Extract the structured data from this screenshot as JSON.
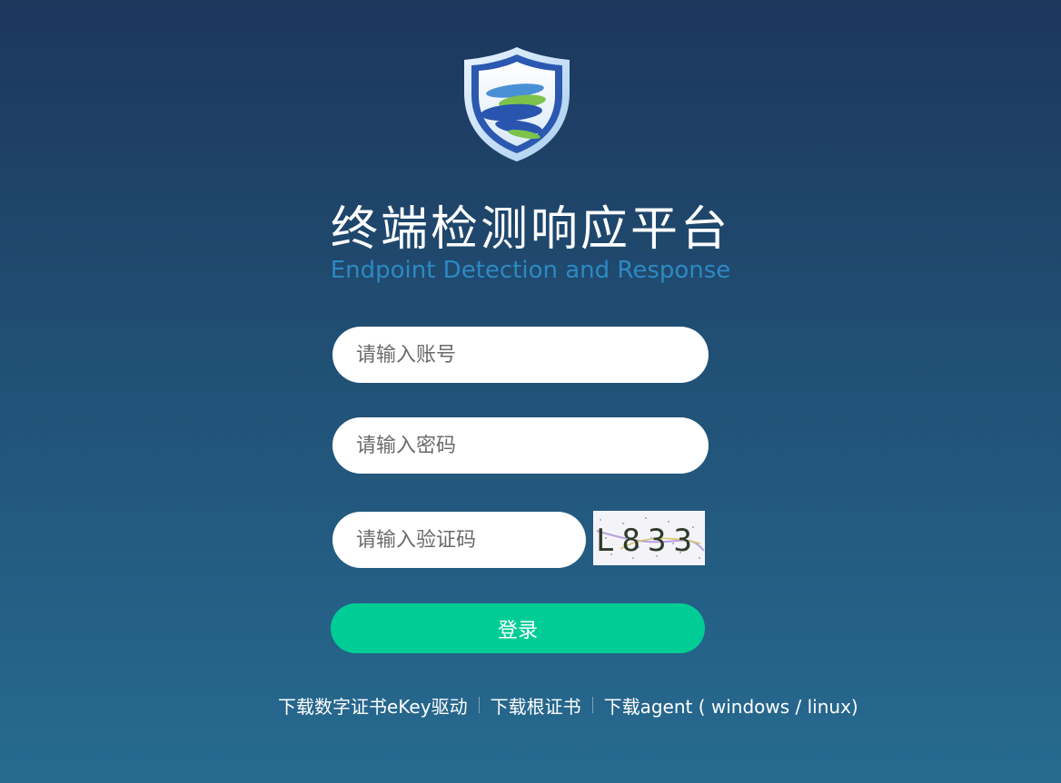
{
  "brand": {
    "title": "终端检测响应平台",
    "subtitle": "Endpoint Detection and Response",
    "logo_icon": "shield-logo-icon"
  },
  "form": {
    "account_placeholder": "请输入账号",
    "password_placeholder": "请输入密码",
    "captcha_placeholder": "请输入验证码",
    "captcha_text": "L833",
    "login_label": "登录"
  },
  "links": {
    "ekey_driver": "下载数字证书eKey驱动",
    "root_cert": "下载根证书",
    "agent": "下载agent ( windows / linux)"
  },
  "colors": {
    "login_button": "#00cd96",
    "subtitle": "#2d89c3",
    "background_top": "#1c365c",
    "background_bottom": "#276b91"
  }
}
